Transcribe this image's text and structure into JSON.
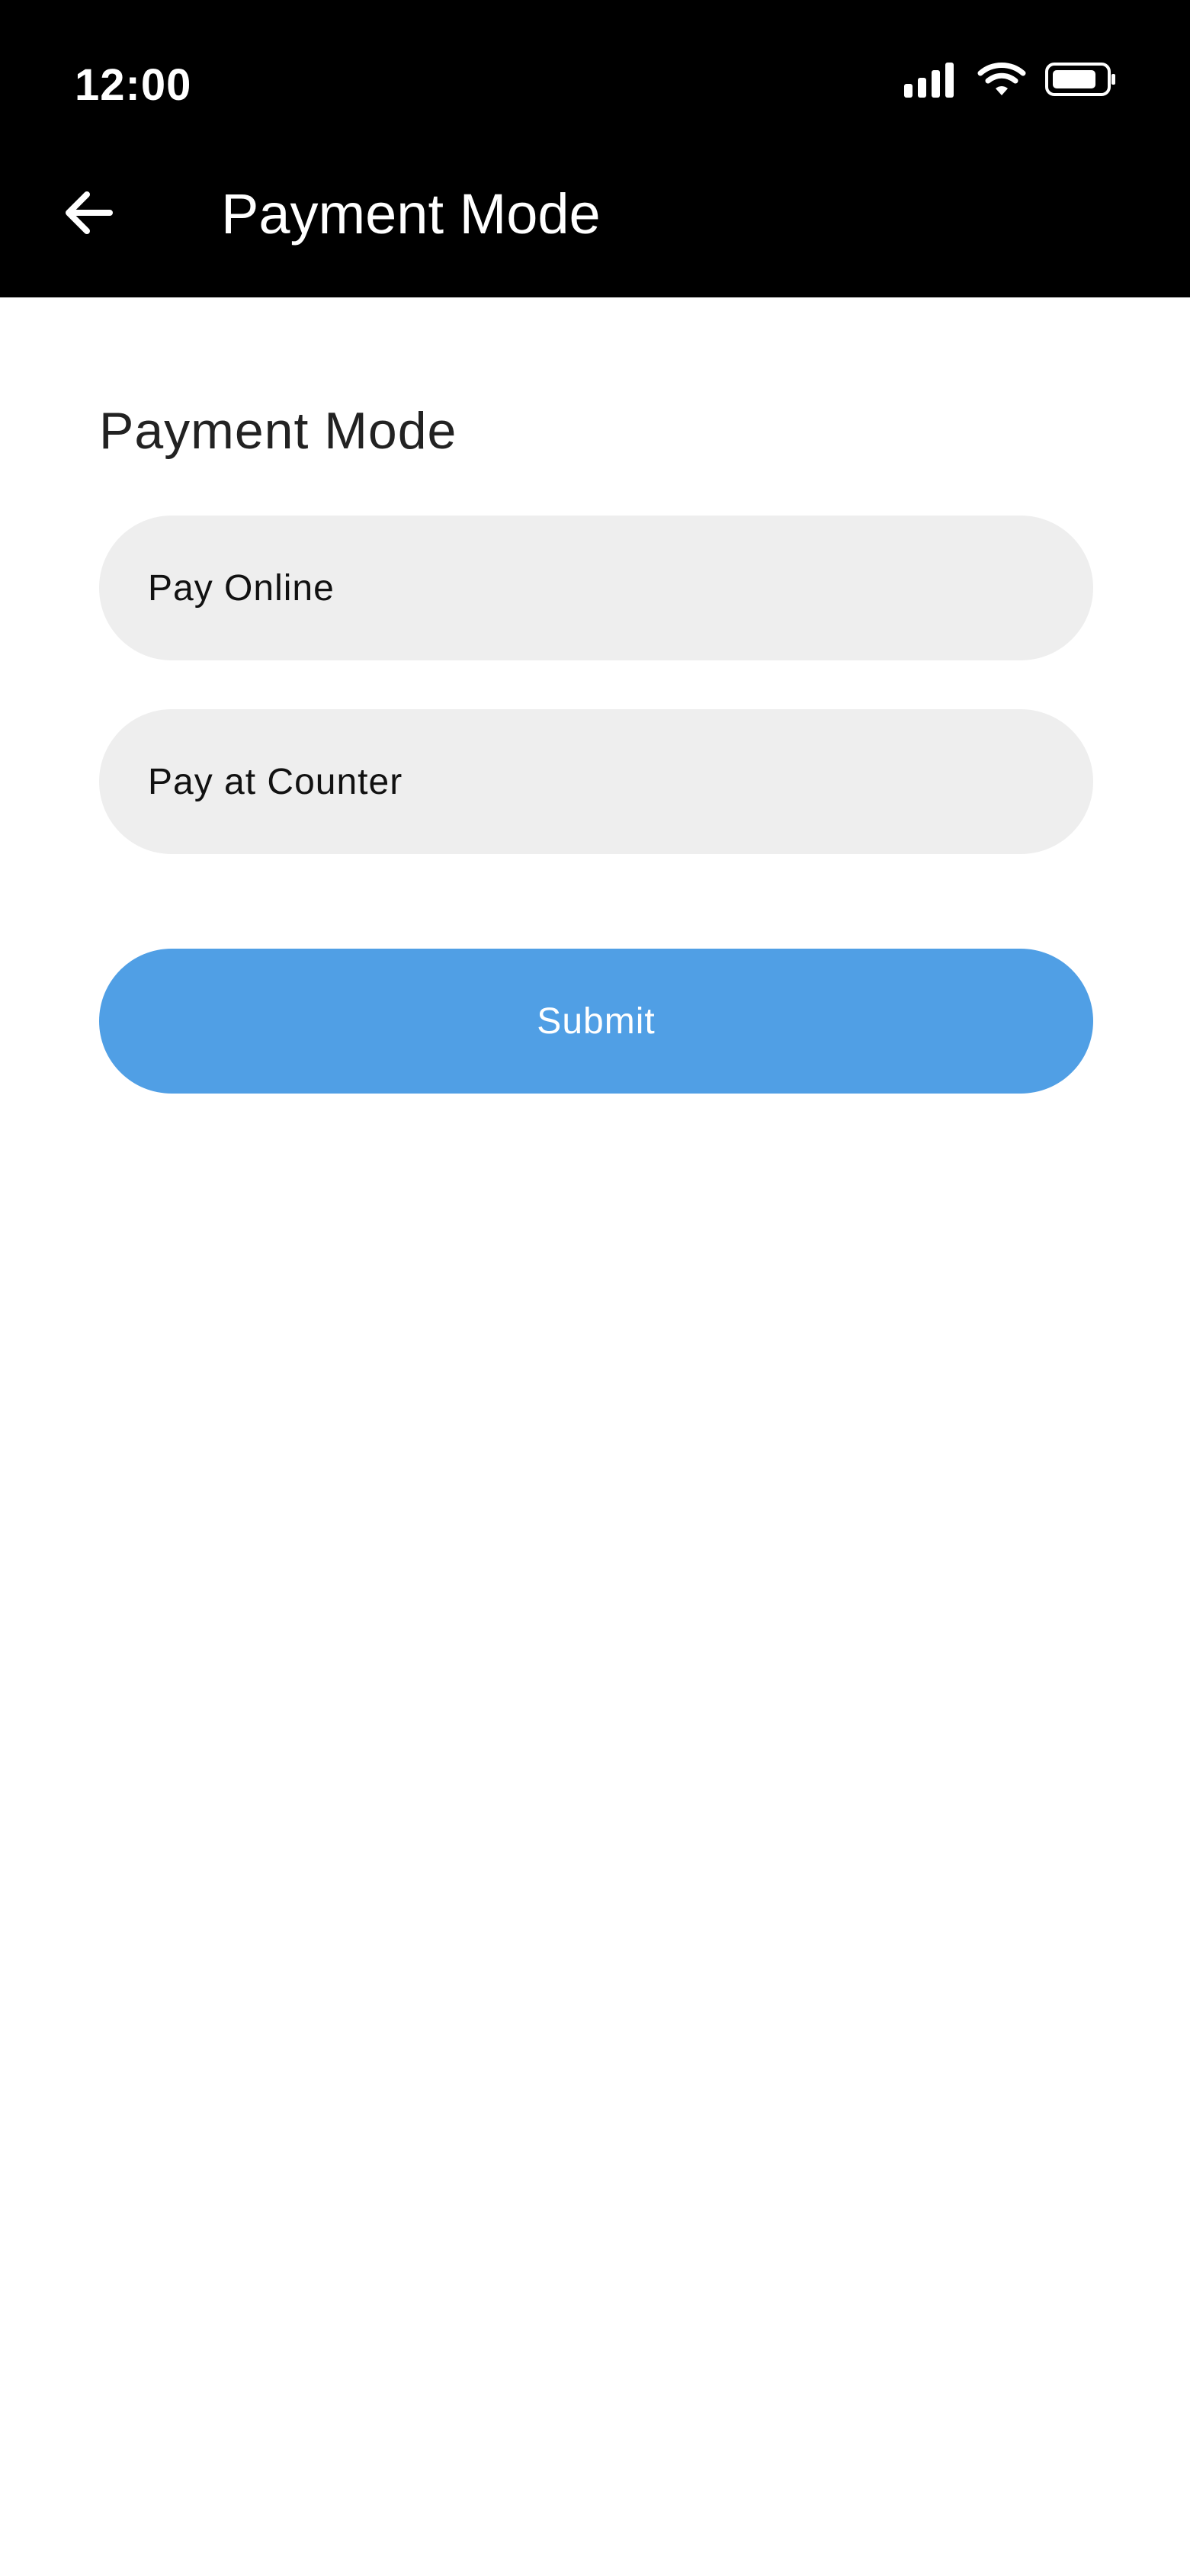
{
  "status_bar": {
    "time": "12:00",
    "icons": [
      "signal-icon",
      "wifi-icon",
      "battery-icon"
    ]
  },
  "app_bar": {
    "back_icon": "arrow-left-icon",
    "title": "Payment Mode"
  },
  "form": {
    "section_title": "Payment Mode",
    "options": [
      {
        "label": "Pay Online"
      },
      {
        "label": "Pay at Counter"
      }
    ],
    "submit_label": "Submit"
  },
  "colors": {
    "header_background": "#000000",
    "option_background": "#eeeeee",
    "submit_background": "#509fe5",
    "submit_text": "#ffffff"
  }
}
